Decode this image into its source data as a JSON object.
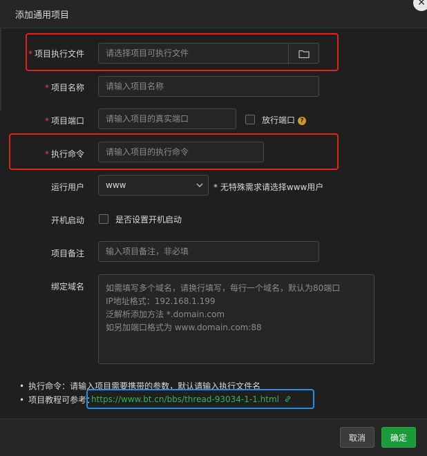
{
  "dialog": {
    "title": "添加通用项目"
  },
  "form": {
    "exec_file": {
      "label": "项目执行文件",
      "placeholder": "请选择项目可执行文件"
    },
    "name": {
      "label": "项目名称",
      "placeholder": "请输入项目名称"
    },
    "port": {
      "label": "项目端口",
      "placeholder": "请输入项目的真实端口",
      "release_label": "放行端口"
    },
    "command": {
      "label": "执行命令",
      "placeholder": "请输入项目的执行命令"
    },
    "run_user": {
      "label": "运行用户",
      "value": "www",
      "hint": "* 无特殊需求请选择www用户"
    },
    "autostart": {
      "label": "开机启动",
      "checkbox_label": "是否设置开机启动"
    },
    "remark": {
      "label": "项目备注",
      "placeholder": "输入项目备注，非必填"
    },
    "domain": {
      "label": "绑定域名",
      "placeholder_lines": [
        "如需填写多个域名，请换行填写，每行一个域名，默认为80端口",
        "IP地址格式：192.168.1.199",
        "泛解析添加方法 *.domain.com",
        "如另加端口格式为 www.domain.com:88"
      ]
    }
  },
  "notes": {
    "cmd_note": "执行命令：请输入项目需要携带的参数，默认请输入执行文件名",
    "tutorial_prefix": "项目教程可参考：",
    "tutorial_link": "https://www.bt.cn/bbs/thread-93034-1-1.html"
  },
  "footer": {
    "cancel": "取消",
    "ok": "确定"
  },
  "colors": {
    "accent": "#1a9a3a",
    "annotation_red": "#e02418",
    "annotation_blue": "#1f8ff0",
    "required": "#e04a3a"
  }
}
